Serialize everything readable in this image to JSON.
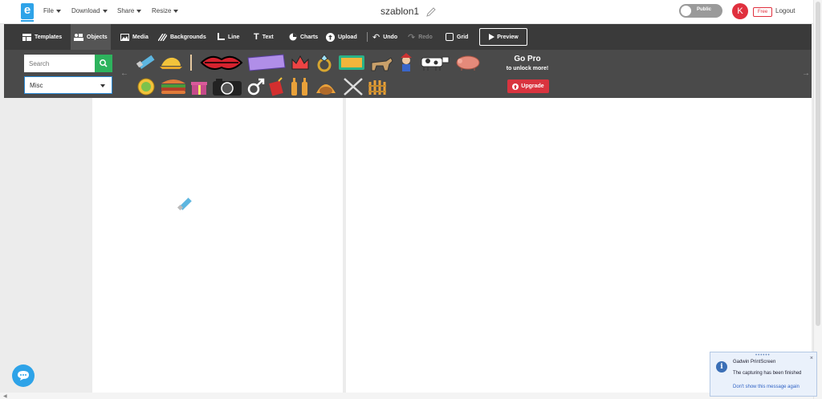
{
  "header": {
    "logo_letter": "e",
    "menus": [
      {
        "label": "File"
      },
      {
        "label": "Download"
      },
      {
        "label": "Share"
      },
      {
        "label": "Resize"
      }
    ],
    "doc_title": "szablon1",
    "visibility_label": "Public",
    "avatar_letter": "K",
    "plan_badge": "Free",
    "logout_label": "Logout"
  },
  "toolbar": {
    "templates": "Templates",
    "objects": "Objects",
    "media": "Media",
    "backgrounds": "Backgrounds",
    "line": "Line",
    "text": "Text",
    "charts": "Charts",
    "upload": "Upload",
    "undo": "Undo",
    "redo": "Redo",
    "grid": "Grid",
    "preview": "Preview"
  },
  "panel": {
    "search_placeholder": "Search",
    "category_selected": "Misc",
    "gopro_title": "Go Pro",
    "gopro_sub": "to unlock more!",
    "upgrade_label": "Upgrade",
    "objects_row1": [
      "usb-drive",
      "hat",
      "stick",
      "lips",
      "ribbon-banner",
      "crown",
      "diamond-ring",
      "tablet",
      "pack-animal",
      "gnome",
      "cow",
      "pig"
    ],
    "objects_row2": [
      "coin",
      "burger",
      "gift-box",
      "camera",
      "male-symbol",
      "firecracker",
      "bottles",
      "turkey",
      "cutlery",
      "fence"
    ]
  },
  "notification": {
    "title": "Gadwin PrintScreen",
    "message": "The capturing has been finished",
    "link": "Don't show this message again"
  },
  "colors": {
    "accent": "#2ea3e8",
    "danger": "#e0303e",
    "search_green": "#2db35d",
    "toolbar_bg": "#3a3a3a",
    "panel_bg": "#4a4a4a"
  }
}
